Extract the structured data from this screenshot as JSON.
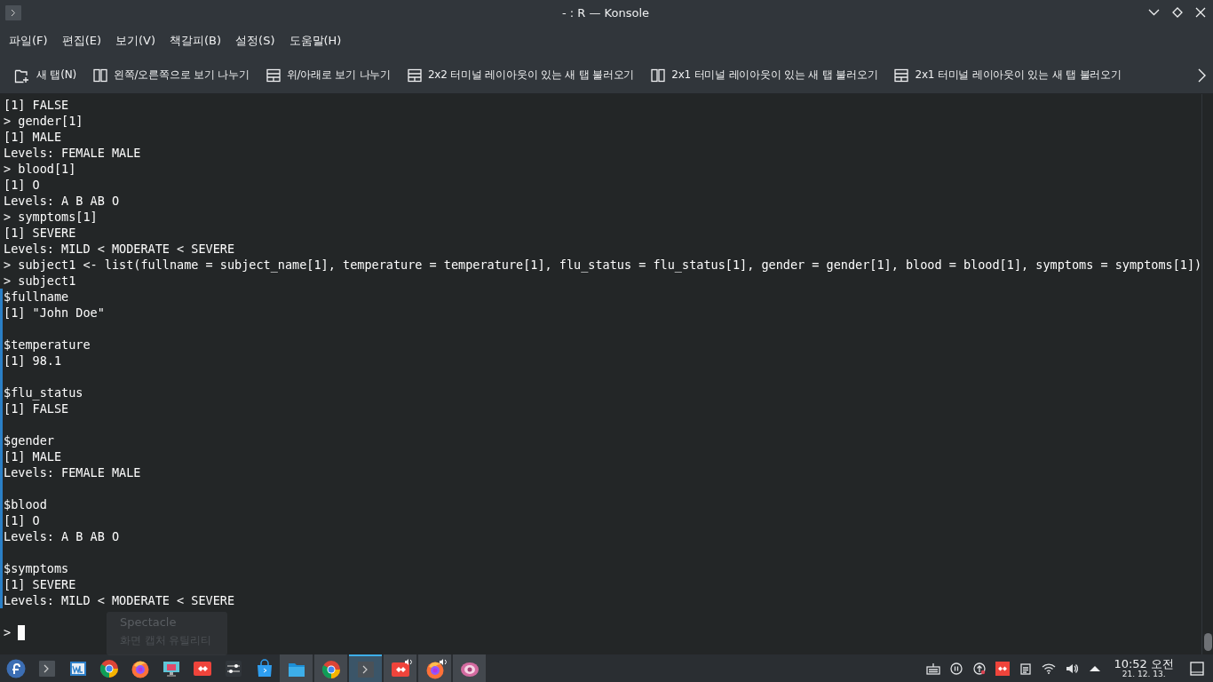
{
  "window": {
    "title": "- : R — Konsole"
  },
  "menu": [
    "파일(F)",
    "편집(E)",
    "보기(V)",
    "책갈피(B)",
    "설정(S)",
    "도움말(H)"
  ],
  "toolbar": [
    {
      "kind": "newtab",
      "label": "새 탭(N)"
    },
    {
      "kind": "columns",
      "label": "왼쪽/오른쪽으로 보기 나누기"
    },
    {
      "kind": "rows",
      "label": "위/아래로 보기 나누기"
    },
    {
      "kind": "rows",
      "label": "2x2 터미널 레이아웃이 있는 새 탭 불러오기"
    },
    {
      "kind": "columns",
      "label": "2x1 터미널 레이아웃이 있는 새 탭 불러오기"
    },
    {
      "kind": "rows",
      "label": "2x1 터미널 레이아웃이 있는 새 탭 불러오기"
    }
  ],
  "terminal": {
    "blocks": [
      {
        "marked": false,
        "lines": [
          "[1] FALSE",
          "> gender[1]",
          "[1] MALE",
          "Levels: FEMALE MALE",
          "> blood[1]",
          "[1] O",
          "Levels: A B AB O",
          "> symptoms[1]",
          "[1] SEVERE",
          "Levels: MILD < MODERATE < SEVERE",
          "> subject1 <- list(fullname = subject_name[1], temperature = temperature[1], flu_status = flu_status[1], gender = gender[1], blood = blood[1], symptoms = symptoms[1])",
          "> subject1"
        ]
      },
      {
        "marked": true,
        "groups": [
          [
            "$fullname",
            "[1] \"John Doe\""
          ],
          [
            "$temperature",
            "[1] 98.1"
          ],
          [
            "$flu_status",
            "[1] FALSE"
          ],
          [
            "$gender",
            "[1] MALE",
            "Levels: FEMALE MALE"
          ],
          [
            "$blood",
            "[1] O",
            "Levels: A B AB O"
          ],
          [
            "$symptoms",
            "[1] SEVERE",
            "Levels: MILD < MODERATE < SEVERE"
          ]
        ]
      }
    ],
    "prompt": ">"
  },
  "tooltip": {
    "title": "Spectacle",
    "subtitle": "화면 캡처 유틸리티"
  },
  "taskbar": {
    "launchers": [
      {
        "kind": "fedora"
      },
      {
        "kind": "terminal"
      },
      {
        "kind": "editor"
      },
      {
        "kind": "chrome"
      },
      {
        "kind": "firefox"
      },
      {
        "kind": "monitor"
      },
      {
        "kind": "anydesk"
      },
      {
        "kind": "sliders"
      },
      {
        "kind": "bag"
      }
    ],
    "tasks": [
      {
        "kind": "folder",
        "selected": false,
        "audio": false
      },
      {
        "kind": "chrome",
        "selected": false,
        "audio": false
      },
      {
        "kind": "terminal",
        "selected": true,
        "audio": false
      },
      {
        "kind": "anydesk",
        "selected": false,
        "audio": true
      },
      {
        "kind": "firefox",
        "selected": false,
        "audio": true
      },
      {
        "kind": "eye",
        "selected": false,
        "audio": false
      }
    ],
    "tray": [
      {
        "kind": "keyboard"
      },
      {
        "kind": "pause"
      },
      {
        "kind": "update"
      },
      {
        "kind": "anydesk"
      },
      {
        "kind": "clipboard"
      },
      {
        "kind": "wifi"
      },
      {
        "kind": "volume"
      },
      {
        "kind": "expand"
      }
    ],
    "clock": {
      "time": "10:52 오전",
      "date": "21. 12. 13."
    }
  }
}
